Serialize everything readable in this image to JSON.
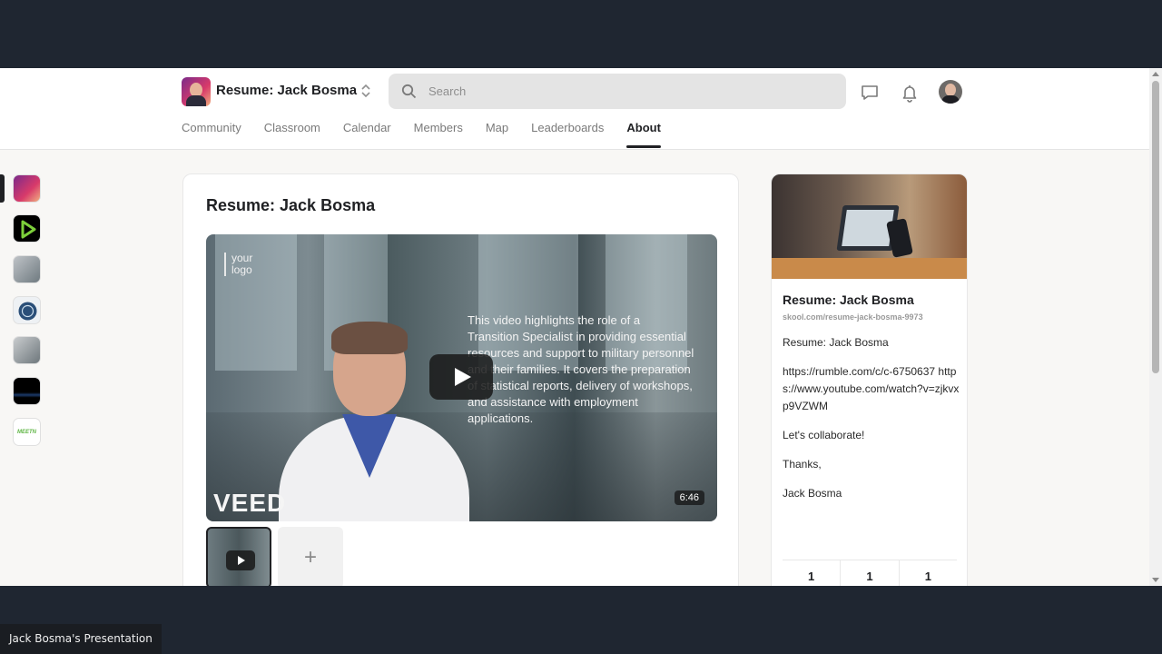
{
  "header": {
    "group_name": "Resume: Jack Bosma",
    "search_placeholder": "Search"
  },
  "nav": {
    "tabs": [
      "Community",
      "Classroom",
      "Calendar",
      "Members",
      "Map",
      "Leaderboards",
      "About"
    ],
    "active": "About"
  },
  "rail": {
    "items": [
      "resume-jack-bosma",
      "rumble",
      "group-3",
      "group-4",
      "group-5",
      "group-6",
      "group-7"
    ],
    "labels": {
      "last": "MEETN"
    }
  },
  "main": {
    "title": "Resume: Jack Bosma",
    "video": {
      "logo_line1": "your",
      "logo_line2": "logo",
      "overlay_text": "This video highlights the role of a Transition Specialist in providing essential resources and support to military personnel and their families. It covers the preparation of statistical reports, delivery of workshops, and assistance with employment applications.",
      "watermark": "VEED",
      "duration": "6:46"
    },
    "add_label": "+"
  },
  "side": {
    "title": "Resume: Jack Bosma",
    "url": "skool.com/resume-jack-bosma-9973",
    "body": [
      "Resume: Jack Bosma",
      "https://rumble.com/c/c-6750637 https://www.youtube.com/watch?v=zjkvxp9VZWM",
      "Let's collaborate!",
      "Thanks,",
      "Jack Bosma"
    ],
    "stats": [
      "1",
      "1",
      "1"
    ]
  },
  "caption": "Jack Bosma's Presentation",
  "colors": {
    "background": "#1f2631",
    "accent": "#202124",
    "search_bg": "#e4e4e4"
  }
}
